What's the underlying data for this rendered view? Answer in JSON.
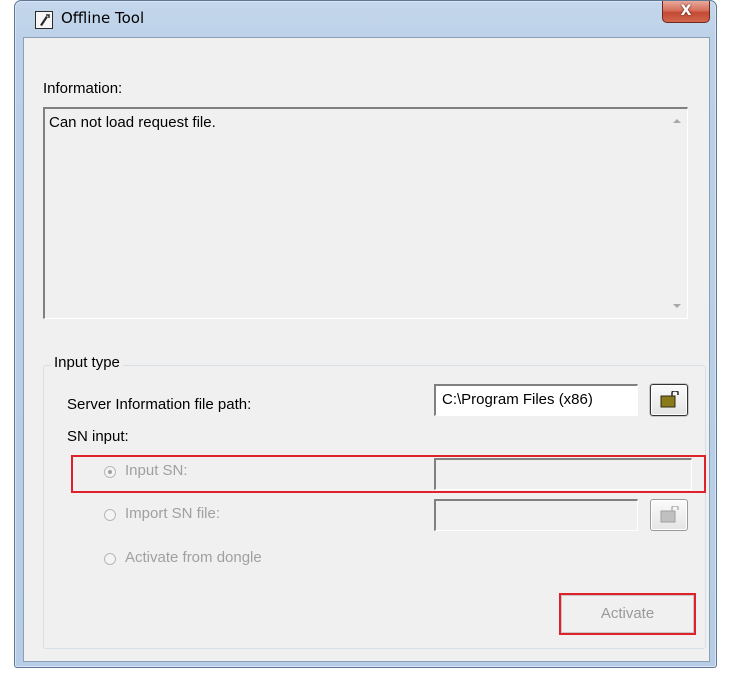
{
  "window": {
    "title": "Offline Tool",
    "close_glyph": "X"
  },
  "information": {
    "label": "Information:",
    "message": "Can not load request file."
  },
  "input_type": {
    "legend": "Input type",
    "server_path_label": "Server Information file path:",
    "server_path_value": "C:\\Program Files (x86)",
    "sn_input_label": "SN input:",
    "options": [
      {
        "label": "Input SN:",
        "selected": true,
        "enabled": false
      },
      {
        "label": "Import SN file:",
        "selected": false,
        "enabled": false
      },
      {
        "label": "Activate from dongle",
        "selected": false,
        "enabled": false
      }
    ],
    "sn_value": "",
    "sn_file_value": ""
  },
  "buttons": {
    "activate": "Activate"
  },
  "icons": {
    "app": "wrench-document-icon",
    "browse": "open-folder-icon"
  },
  "colors": {
    "highlight": "#e0202a",
    "disabled_text": "#a0a0a0",
    "title_bar": "#bcd1e8"
  }
}
